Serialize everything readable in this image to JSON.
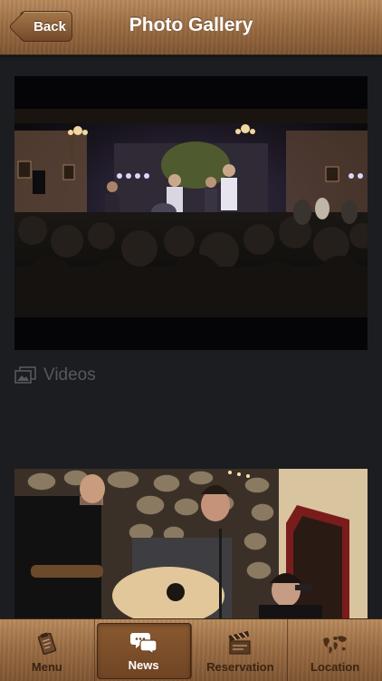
{
  "header": {
    "back_label": "Back",
    "title": "Photo Gallery"
  },
  "gallery": {
    "section_label": "Videos",
    "section_icon": "photo-stack-icon"
  },
  "tabs": [
    {
      "label": "Menu",
      "icon": "clipboard-icon",
      "active": false
    },
    {
      "label": "News",
      "icon": "speech-bubbles-icon",
      "active": true
    },
    {
      "label": "Reservation",
      "icon": "clapperboard-icon",
      "active": false
    },
    {
      "label": "Location",
      "icon": "world-map-icon",
      "active": false
    }
  ],
  "colors": {
    "background": "#1c1d20",
    "wood": "#9c6e44",
    "label": "#56585c"
  }
}
